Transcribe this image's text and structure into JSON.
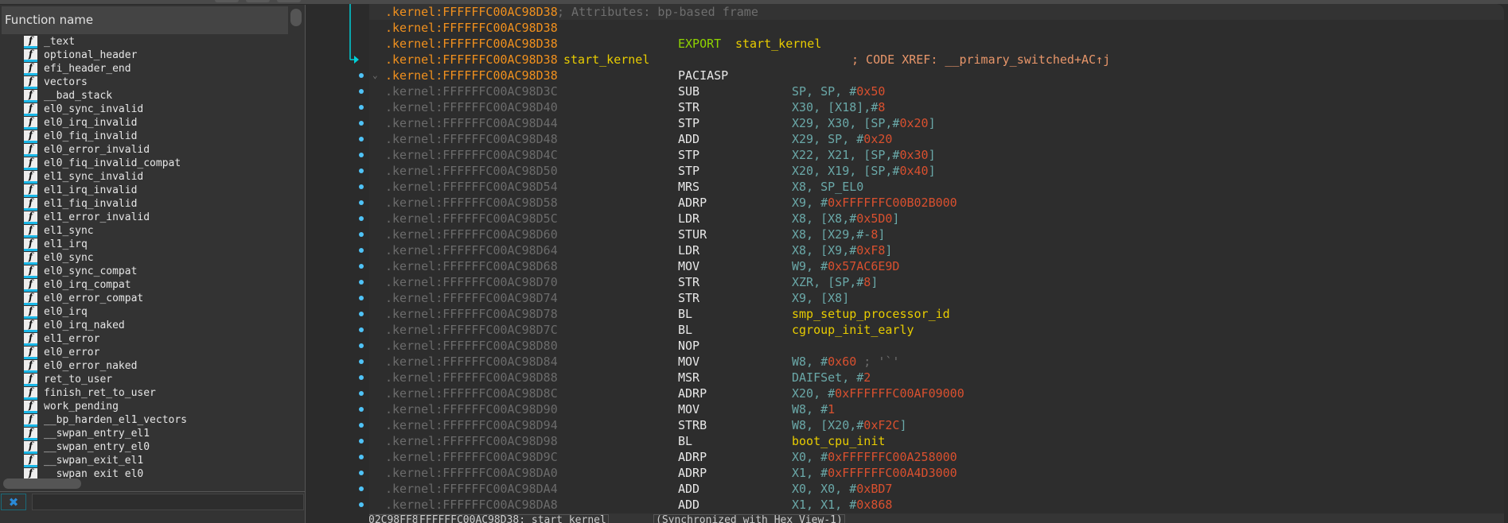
{
  "function_panel": {
    "header": "Function name",
    "items": [
      "_text",
      "optional_header",
      "efi_header_end",
      "vectors",
      "__bad_stack",
      "el0_sync_invalid",
      "el0_irq_invalid",
      "el0_fiq_invalid",
      "el0_error_invalid",
      "el0_fiq_invalid_compat",
      "el1_sync_invalid",
      "el1_irq_invalid",
      "el1_fiq_invalid",
      "el1_error_invalid",
      "el1_sync",
      "el1_irq",
      "el0_sync",
      "el0_sync_compat",
      "el0_irq_compat",
      "el0_error_compat",
      "el0_irq",
      "el0_irq_naked",
      "el1_error",
      "el0_error",
      "el0_error_naked",
      "ret_to_user",
      "finish_ret_to_user",
      "work_pending",
      "__bp_harden_el1_vectors",
      "__swpan_entry_el1",
      "__swpan_entry_el0",
      "__swpan_exit_el1",
      "__swpan_exit_el0"
    ],
    "item_icon": "function-icon",
    "close_icon": "close-icon",
    "filter_value": ""
  },
  "colors": {
    "addr_head": "#f0901e",
    "addr": "#6b6b6b",
    "mnem": "#e8e8e8",
    "reg": "#6aa8a8",
    "num": "#d9502f",
    "name": "#e8cc00",
    "kw": "#8fd400",
    "comment": "#e8966a",
    "attr_comment": "#6e6e6e",
    "punct": "#b0b0b0",
    "label": "#e8cc00",
    "accent": "#4fc3f7"
  },
  "disasm": {
    "rows": [
      {
        "addr": ".kernel:FFFFFFC00AC98D38",
        "head": true,
        "attr": "; Attributes: bp-based frame"
      },
      {
        "addr": ".kernel:FFFFFFC00AC98D38",
        "head": true
      },
      {
        "addr": ".kernel:FFFFFFC00AC98D38",
        "head": true,
        "kw": "EXPORT",
        "kwarg": "start_kernel"
      },
      {
        "addr": ".kernel:FFFFFFC00AC98D38",
        "head": true,
        "label": "start_kernel",
        "comment": "; CODE XREF: __primary_switched+AC↑j"
      },
      {
        "addr": ".kernel:FFFFFFC00AC98D38",
        "head": true,
        "mnem": "PACIASP",
        "dot": true,
        "collapse": true
      },
      {
        "addr": ".kernel:FFFFFFC00AC98D3C",
        "mnem": "SUB",
        "ops": [
          [
            "SP, SP, #",
            "reg"
          ],
          [
            "0x50",
            "num"
          ]
        ],
        "dot": true
      },
      {
        "addr": ".kernel:FFFFFFC00AC98D40",
        "mnem": "STR",
        "ops": [
          [
            "X30, [X18],#",
            "reg"
          ],
          [
            "8",
            "num"
          ]
        ],
        "dot": true
      },
      {
        "addr": ".kernel:FFFFFFC00AC98D44",
        "mnem": "STP",
        "ops": [
          [
            "X29, X30, [SP,#",
            "reg"
          ],
          [
            "0x20",
            "num"
          ],
          [
            "]",
            "reg"
          ]
        ],
        "dot": true
      },
      {
        "addr": ".kernel:FFFFFFC00AC98D48",
        "mnem": "ADD",
        "ops": [
          [
            "X29, SP, #",
            "reg"
          ],
          [
            "0x20",
            "num"
          ]
        ],
        "dot": true
      },
      {
        "addr": ".kernel:FFFFFFC00AC98D4C",
        "mnem": "STP",
        "ops": [
          [
            "X22, X21, [SP,#",
            "reg"
          ],
          [
            "0x30",
            "num"
          ],
          [
            "]",
            "reg"
          ]
        ],
        "dot": true
      },
      {
        "addr": ".kernel:FFFFFFC00AC98D50",
        "mnem": "STP",
        "ops": [
          [
            "X20, X19, [SP,#",
            "reg"
          ],
          [
            "0x40",
            "num"
          ],
          [
            "]",
            "reg"
          ]
        ],
        "dot": true
      },
      {
        "addr": ".kernel:FFFFFFC00AC98D54",
        "mnem": "MRS",
        "ops": [
          [
            "X8, SP_EL0",
            "reg"
          ]
        ],
        "dot": true
      },
      {
        "addr": ".kernel:FFFFFFC00AC98D58",
        "mnem": "ADRP",
        "ops": [
          [
            "X9, #",
            "reg"
          ],
          [
            "0xFFFFFFC00B02B000",
            "num"
          ]
        ],
        "dot": true
      },
      {
        "addr": ".kernel:FFFFFFC00AC98D5C",
        "mnem": "LDR",
        "ops": [
          [
            "X8, [X8,#",
            "reg"
          ],
          [
            "0x5D0",
            "num"
          ],
          [
            "]",
            "reg"
          ]
        ],
        "dot": true
      },
      {
        "addr": ".kernel:FFFFFFC00AC98D60",
        "mnem": "STUR",
        "ops": [
          [
            "X8, [X29,#-",
            "reg"
          ],
          [
            "8",
            "num"
          ],
          [
            "]",
            "reg"
          ]
        ],
        "dot": true
      },
      {
        "addr": ".kernel:FFFFFFC00AC98D64",
        "mnem": "LDR",
        "ops": [
          [
            "X8, [X9,#",
            "reg"
          ],
          [
            "0xF8",
            "num"
          ],
          [
            "]",
            "reg"
          ]
        ],
        "dot": true
      },
      {
        "addr": ".kernel:FFFFFFC00AC98D68",
        "mnem": "MOV",
        "ops": [
          [
            "W9, #",
            "reg"
          ],
          [
            "0x57AC6E9D",
            "num"
          ]
        ],
        "dot": true
      },
      {
        "addr": ".kernel:FFFFFFC00AC98D70",
        "mnem": "STR",
        "ops": [
          [
            "XZR, [SP,#",
            "reg"
          ],
          [
            "8",
            "num"
          ],
          [
            "]",
            "reg"
          ]
        ],
        "dot": true
      },
      {
        "addr": ".kernel:FFFFFFC00AC98D74",
        "mnem": "STR",
        "ops": [
          [
            "X9, [X8]",
            "reg"
          ]
        ],
        "dot": true
      },
      {
        "addr": ".kernel:FFFFFFC00AC98D78",
        "mnem": "BL",
        "ops": [
          [
            "smp_setup_processor_id",
            "name"
          ]
        ],
        "dot": true
      },
      {
        "addr": ".kernel:FFFFFFC00AC98D7C",
        "mnem": "BL",
        "ops": [
          [
            "cgroup_init_early",
            "name"
          ]
        ],
        "dot": true
      },
      {
        "addr": ".kernel:FFFFFFC00AC98D80",
        "mnem": "NOP",
        "dot": true
      },
      {
        "addr": ".kernel:FFFFFFC00AC98D84",
        "mnem": "MOV",
        "ops": [
          [
            "W8, #",
            "reg"
          ],
          [
            "0x60",
            "num"
          ],
          [
            " ; '`'",
            "attr"
          ]
        ],
        "dot": true
      },
      {
        "addr": ".kernel:FFFFFFC00AC98D88",
        "mnem": "MSR",
        "ops": [
          [
            "DAIFSet, #",
            "reg"
          ],
          [
            "2",
            "num"
          ]
        ],
        "dot": true
      },
      {
        "addr": ".kernel:FFFFFFC00AC98D8C",
        "mnem": "ADRP",
        "ops": [
          [
            "X20, #",
            "reg"
          ],
          [
            "0xFFFFFFC00AF09000",
            "num"
          ]
        ],
        "dot": true
      },
      {
        "addr": ".kernel:FFFFFFC00AC98D90",
        "mnem": "MOV",
        "ops": [
          [
            "W8, #",
            "reg"
          ],
          [
            "1",
            "num"
          ]
        ],
        "dot": true
      },
      {
        "addr": ".kernel:FFFFFFC00AC98D94",
        "mnem": "STRB",
        "ops": [
          [
            "W8, [X20,#",
            "reg"
          ],
          [
            "0xF2C",
            "num"
          ],
          [
            "]",
            "reg"
          ]
        ],
        "dot": true
      },
      {
        "addr": ".kernel:FFFFFFC00AC98D98",
        "mnem": "BL",
        "ops": [
          [
            "boot_cpu_init",
            "name"
          ]
        ],
        "dot": true
      },
      {
        "addr": ".kernel:FFFFFFC00AC98D9C",
        "mnem": "ADRP",
        "ops": [
          [
            "X0, #",
            "reg"
          ],
          [
            "0xFFFFFFC00A258000",
            "num"
          ]
        ],
        "dot": true
      },
      {
        "addr": ".kernel:FFFFFFC00AC98DA0",
        "mnem": "ADRP",
        "ops": [
          [
            "X1, #",
            "reg"
          ],
          [
            "0xFFFFFFC00A4D3000",
            "num"
          ]
        ],
        "dot": true
      },
      {
        "addr": ".kernel:FFFFFFC00AC98DA4",
        "mnem": "ADD",
        "ops": [
          [
            "X0, X0, #",
            "reg"
          ],
          [
            "0xBD7",
            "num"
          ]
        ],
        "dot": true
      },
      {
        "addr": ".kernel:FFFFFFC00AC98DA8",
        "mnem": "ADD",
        "ops": [
          [
            "X1, X1, #",
            "reg"
          ],
          [
            "0x868",
            "num"
          ]
        ],
        "dot": true
      }
    ]
  },
  "status_bar": {
    "offset": "02C98FF8",
    "location": "FFFFFFC00AC98D38: start_kernel",
    "sync": "(Synchronized with Hex View-1)"
  }
}
